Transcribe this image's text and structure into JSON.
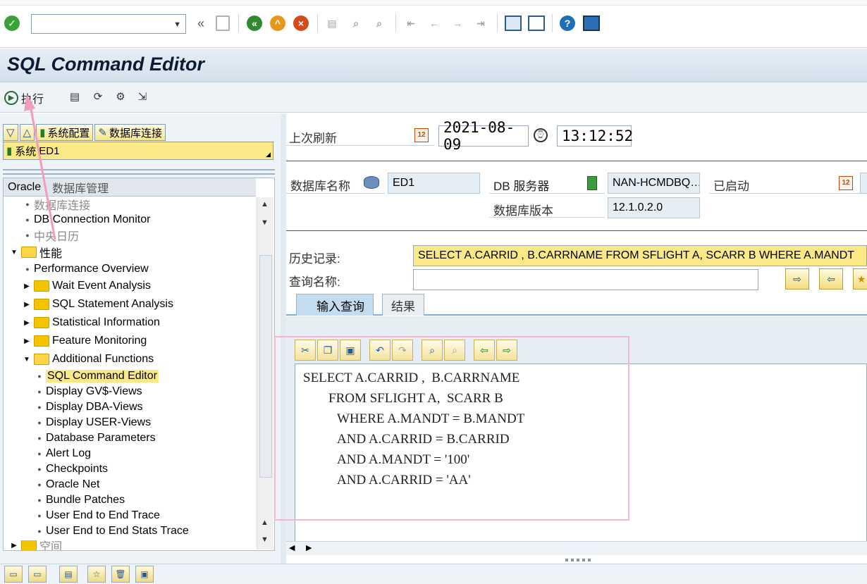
{
  "window": {
    "title": "SQL Command Editor"
  },
  "system_toolbar": {
    "command_field_value": "",
    "icons": [
      "enter-icon",
      "back-icon",
      "save-icon",
      "back-nav-icon",
      "exit-icon",
      "cancel-icon",
      "print-icon",
      "find-icon",
      "find-next-icon",
      "first-page-icon",
      "prev-page-icon",
      "next-page-icon",
      "last-page-icon",
      "create-session-icon",
      "shortcut-icon",
      "help-icon",
      "layout-icon"
    ]
  },
  "app_toolbar": {
    "execute_label": "执行"
  },
  "left_pane": {
    "tabs": [
      {
        "label": ""
      },
      {
        "label": ""
      },
      {
        "label": "系统配置"
      },
      {
        "label": "数据库连接"
      }
    ],
    "system_label": "系统",
    "system_value": "ED1",
    "tree_header": {
      "col1": "Oracle",
      "col2": "数据库管理"
    },
    "tree": [
      {
        "label": "数据库连接",
        "level": 1,
        "type": "leaf"
      },
      {
        "label": "DB Connection Monitor",
        "level": 1,
        "type": "leaf"
      },
      {
        "label": "中央日历",
        "level": 1,
        "type": "leaf"
      },
      {
        "label": "性能",
        "level": 0,
        "type": "folder-open"
      },
      {
        "label": "Performance Overview",
        "level": 1,
        "type": "leaf"
      },
      {
        "label": "Wait Event Analysis",
        "level": 1,
        "type": "folder"
      },
      {
        "label": "SQL Statement Analysis",
        "level": 1,
        "type": "folder"
      },
      {
        "label": "Statistical Information",
        "level": 1,
        "type": "folder"
      },
      {
        "label": "Feature Monitoring",
        "level": 1,
        "type": "folder"
      },
      {
        "label": "Additional Functions",
        "level": 1,
        "type": "folder-open"
      },
      {
        "label": "SQL Command Editor",
        "level": 2,
        "type": "leaf",
        "selected": true
      },
      {
        "label": "Display GV$-Views",
        "level": 2,
        "type": "leaf"
      },
      {
        "label": "Display DBA-Views",
        "level": 2,
        "type": "leaf"
      },
      {
        "label": "Display USER-Views",
        "level": 2,
        "type": "leaf"
      },
      {
        "label": "Database Parameters",
        "level": 2,
        "type": "leaf"
      },
      {
        "label": "Alert Log",
        "level": 2,
        "type": "leaf"
      },
      {
        "label": "Checkpoints",
        "level": 2,
        "type": "leaf"
      },
      {
        "label": "Oracle Net",
        "level": 2,
        "type": "leaf"
      },
      {
        "label": "Bundle Patches",
        "level": 2,
        "type": "leaf"
      },
      {
        "label": "User End to End Trace",
        "level": 2,
        "type": "leaf"
      },
      {
        "label": "User End to End Stats Trace",
        "level": 2,
        "type": "leaf"
      },
      {
        "label": "空间",
        "level": 0,
        "type": "folder"
      }
    ]
  },
  "right_pane": {
    "last_refresh_label": "上次刷新",
    "last_refresh_date": "2021-08-09",
    "last_refresh_time": "13:12:52",
    "db_name_label": "数据库名称",
    "db_name_value": "ED1",
    "db_server_label": "DB 服务器",
    "db_server_value": "NAN-HCMDBQ…",
    "started_label": "已启动",
    "db_version_label": "数据库版本",
    "db_version_value": "12.1.0.2.0",
    "history_label": "历史记录:",
    "history_value": "SELECT A.CARRID , B.CARRNAME FROM SFLIGHT A, SCARR B WHERE A.MANDT",
    "query_name_label": "查询名称:",
    "query_name_value": "",
    "tabs": [
      {
        "label": "输入查询",
        "active": true
      },
      {
        "label": "结果",
        "active": false
      }
    ],
    "sql_lines": [
      "SELECT A.CARRID ,  B.CARRNAME",
      "FROM SFLIGHT A,  SCARR B",
      "WHERE A.MANDT = B.MANDT",
      "AND A.CARRID = B.CARRID",
      "AND A.MANDT = '100'",
      "AND A.CARRID = 'AA'"
    ]
  }
}
